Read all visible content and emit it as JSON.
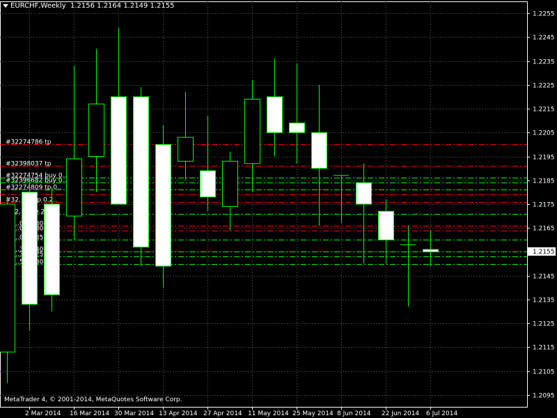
{
  "header": {
    "symbol": "EURCHF,Weekly",
    "ohlc": "1.2156 1.2164 1.2149 1.2155"
  },
  "copyright": "MetaTrader 4, © 2001-2014, MetaQuotes Software Corp.",
  "colors": {
    "background": "#000000",
    "grid": "#3a3a3a",
    "bull_body": "#000000",
    "bear_body": "#ffffff",
    "candle_outline": "#00ff00",
    "sl_line": "#ff0000",
    "tp_line": "#00ff00",
    "text": "#ffffff"
  },
  "chart_data": {
    "type": "candlestick",
    "ylim": [
      1.209,
      1.226
    ],
    "y_ticks": [
      "1.2255",
      "1.2245",
      "1.2235",
      "1.2225",
      "1.2215",
      "1.2205",
      "1.2195",
      "1.2185",
      "1.2175",
      "1.2165",
      "1.2155",
      "1.2145",
      "1.2135",
      "1.2125",
      "1.2115",
      "1.2105",
      "1.2095"
    ],
    "current_price": "1.2155",
    "x_labels": [
      "2 Mar 2014",
      "16 Mar 2014",
      "30 Mar 2014",
      "13 Apr 2014",
      "27 Apr 2014",
      "11 May 2014",
      "25 May 2014",
      "8 Jun 2014",
      "22 Jun 2014",
      "6 Jul 2014"
    ],
    "candles": [
      {
        "o": 1.2113,
        "h": 1.2178,
        "l": 1.21,
        "c": 1.2175
      },
      {
        "o": 1.218,
        "h": 1.2187,
        "l": 1.2122,
        "c": 1.2133
      },
      {
        "o": 1.2175,
        "h": 1.2182,
        "l": 1.213,
        "c": 1.2137
      },
      {
        "o": 1.217,
        "h": 1.2233,
        "l": 1.216,
        "c": 1.2194
      },
      {
        "o": 1.2195,
        "h": 1.224,
        "l": 1.218,
        "c": 1.2217
      },
      {
        "o": 1.222,
        "h": 1.2249,
        "l": 1.2185,
        "c": 1.2175
      },
      {
        "o": 1.222,
        "h": 1.2224,
        "l": 1.2149,
        "c": 1.2157
      },
      {
        "o": 1.22,
        "h": 1.2208,
        "l": 1.214,
        "c": 1.2149
      },
      {
        "o": 1.2193,
        "h": 1.2222,
        "l": 1.2185,
        "c": 1.2203
      },
      {
        "o": 1.2189,
        "h": 1.2212,
        "l": 1.2172,
        "c": 1.2178
      },
      {
        "o": 1.2174,
        "h": 1.2197,
        "l": 1.2164,
        "c": 1.2193
      },
      {
        "o": 1.2192,
        "h": 1.2227,
        "l": 1.218,
        "c": 1.2219
      },
      {
        "o": 1.222,
        "h": 1.2236,
        "l": 1.2195,
        "c": 1.2205
      },
      {
        "o": 1.2209,
        "h": 1.2234,
        "l": 1.2192,
        "c": 1.2205
      },
      {
        "o": 1.2205,
        "h": 1.2225,
        "l": 1.2166,
        "c": 1.219
      },
      {
        "o": 1.2187,
        "h": 1.2187,
        "l": 1.2167,
        "c": 1.2187
      },
      {
        "o": 1.2184,
        "h": 1.2192,
        "l": 1.215,
        "c": 1.2175
      },
      {
        "o": 1.2172,
        "h": 1.2177,
        "l": 1.215,
        "c": 1.216
      },
      {
        "o": 1.2158,
        "h": 1.2166,
        "l": 1.2132,
        "c": 1.2158
      },
      {
        "o": 1.2156,
        "h": 1.2164,
        "l": 1.2149,
        "c": 1.2155
      }
    ],
    "order_lines": [
      {
        "price": 1.22,
        "kind": "sl",
        "label": "#32274786 tp"
      },
      {
        "price": 1.2191,
        "kind": "sl",
        "label": "#32398037 tp"
      },
      {
        "price": 1.2186,
        "kind": "tp",
        "label": "#32274754 buy 0.."
      },
      {
        "price": 1.2184,
        "kind": "tp",
        "label": "#32396682 buy 0.."
      },
      {
        "price": 1.2181,
        "kind": "tp",
        "label": "#32274809 tp 0.."
      },
      {
        "price": 1.2179,
        "kind": "sl",
        "label": ""
      },
      {
        "price": 1.2176,
        "kind": "sl",
        "label": "#32...58 tp 0.2.."
      },
      {
        "price": 1.2171,
        "kind": "tp",
        "label": "#32...86 0.2"
      },
      {
        "price": 1.2166,
        "kind": "sl",
        "label": "32...02 0.30"
      },
      {
        "price": 1.2164,
        "kind": "sl",
        "label": "32...02 0.30"
      },
      {
        "price": 1.216,
        "kind": "tp",
        "label": "32...09 0.35"
      },
      {
        "price": 1.2155,
        "kind": "tp",
        "label": "32...32 0.40"
      },
      {
        "price": 1.2153,
        "kind": "tp",
        "label": "32...32 0.25"
      },
      {
        "price": 1.215,
        "kind": "tp",
        "label": "32...58 0.30"
      }
    ]
  }
}
